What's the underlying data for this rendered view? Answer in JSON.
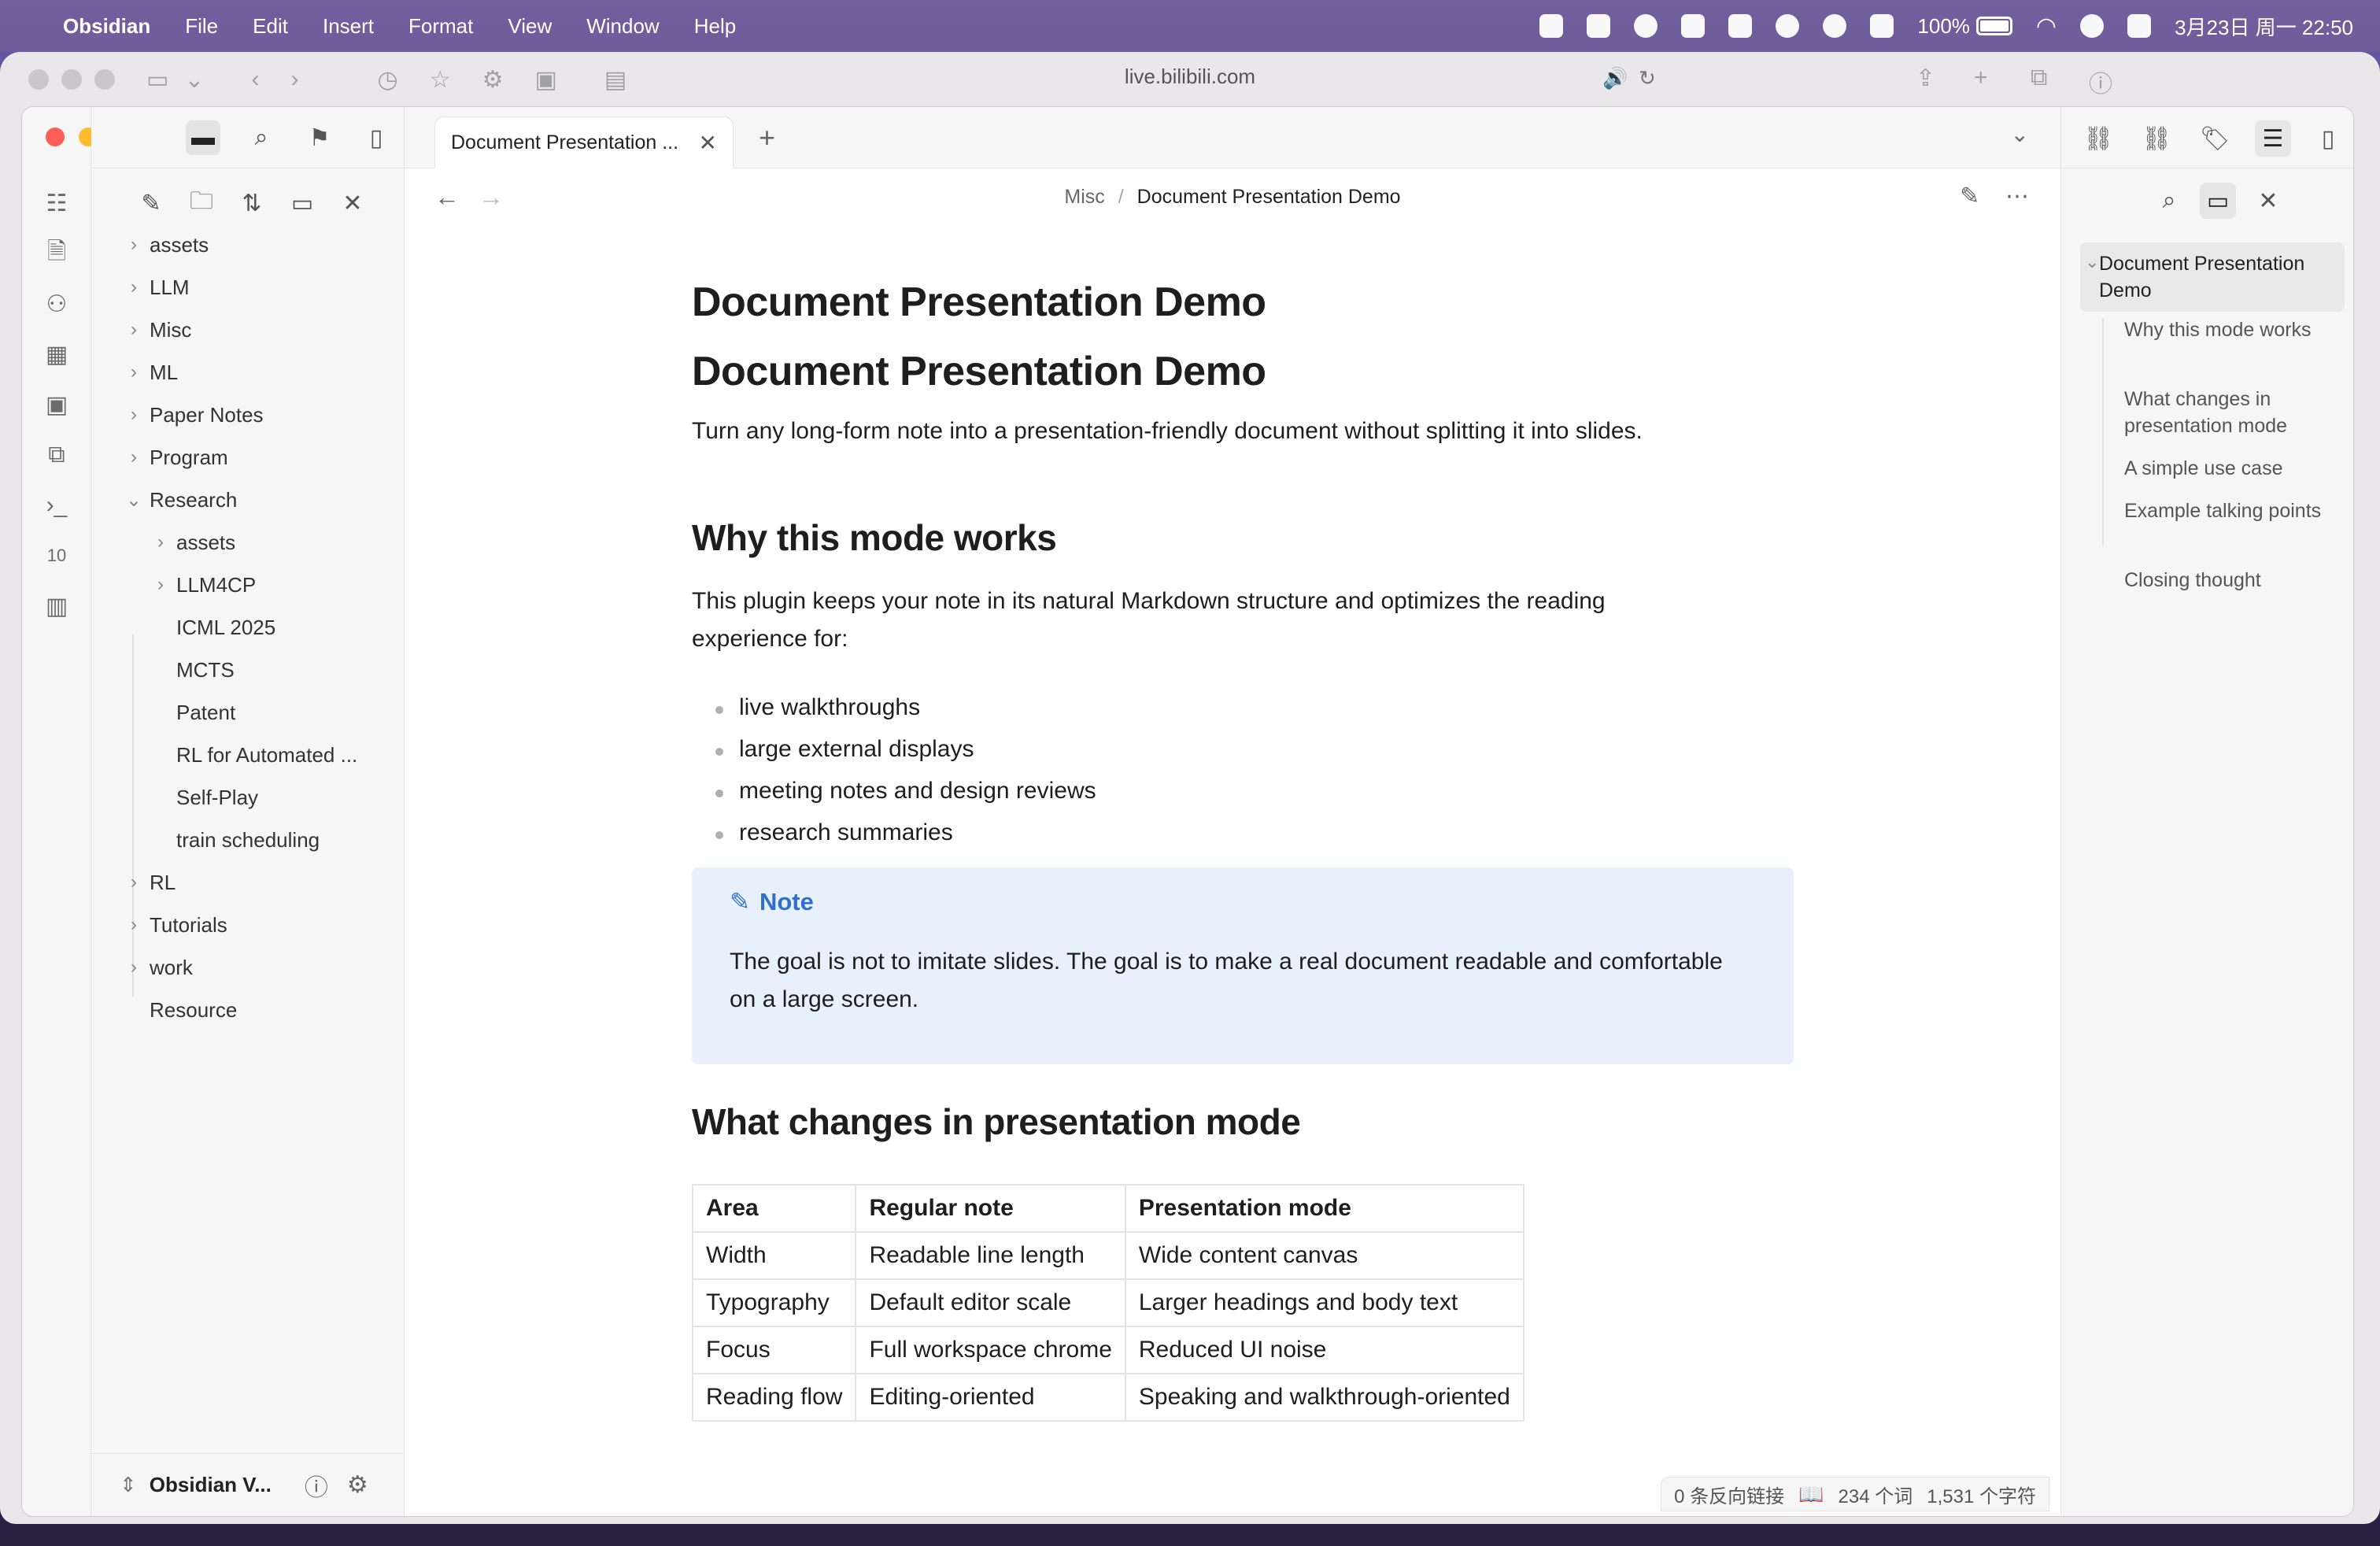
{
  "menubar": {
    "app": "Obsidian",
    "items": [
      "File",
      "Edit",
      "Insert",
      "Format",
      "View",
      "Window",
      "Help"
    ],
    "battery": "100%",
    "datetime": "3月23日 周一  22:50"
  },
  "browser": {
    "address": "live.bilibili.com"
  },
  "sidebar": {
    "tree": [
      {
        "label": "assets",
        "depth": 0,
        "folder": true,
        "open": false
      },
      {
        "label": "LLM",
        "depth": 0,
        "folder": true,
        "open": false
      },
      {
        "label": "Misc",
        "depth": 0,
        "folder": true,
        "open": false
      },
      {
        "label": "ML",
        "depth": 0,
        "folder": true,
        "open": false
      },
      {
        "label": "Paper Notes",
        "depth": 0,
        "folder": true,
        "open": false
      },
      {
        "label": "Program",
        "depth": 0,
        "folder": true,
        "open": false
      },
      {
        "label": "Research",
        "depth": 0,
        "folder": true,
        "open": true
      },
      {
        "label": "assets",
        "depth": 1,
        "folder": true,
        "open": false
      },
      {
        "label": "LLM4CP",
        "depth": 1,
        "folder": true,
        "open": false
      },
      {
        "label": "ICML 2025",
        "depth": 1,
        "folder": false
      },
      {
        "label": "MCTS",
        "depth": 1,
        "folder": false
      },
      {
        "label": "Patent",
        "depth": 1,
        "folder": false
      },
      {
        "label": "RL for Automated ...",
        "depth": 1,
        "folder": false
      },
      {
        "label": "Self-Play",
        "depth": 1,
        "folder": false
      },
      {
        "label": "train scheduling",
        "depth": 1,
        "folder": false
      },
      {
        "label": "RL",
        "depth": 0,
        "folder": true,
        "open": false
      },
      {
        "label": "Tutorials",
        "depth": 0,
        "folder": true,
        "open": false
      },
      {
        "label": "work",
        "depth": 0,
        "folder": true,
        "open": false
      },
      {
        "label": "Resource",
        "depth": 0,
        "folder": false
      }
    ],
    "vault": "Obsidian V..."
  },
  "tab": {
    "title": "Document Presentation ..."
  },
  "breadcrumb": {
    "folder": "Misc",
    "sep": "/",
    "current": "Document Presentation Demo"
  },
  "doc": {
    "title1": "Document Presentation Demo",
    "title2": "Document Presentation Demo",
    "intro": "Turn any long-form note into a presentation-friendly document without splitting it into slides.",
    "h_why": "Why this mode works",
    "why_text": "This plugin keeps your note in its natural Markdown structure and optimizes the reading experience for:",
    "bullets": [
      "live walkthroughs",
      "large external displays",
      "meeting notes and design reviews",
      "research summaries"
    ],
    "callout_title": "Note",
    "callout_body": "The goal is not to imitate slides. The goal is to make a real document readable and comfortable on a large screen.",
    "h_changes": "What changes in presentation mode",
    "table": {
      "headers": [
        "Area",
        "Regular note",
        "Presentation mode"
      ],
      "rows": [
        [
          "Width",
          "Readable line length",
          "Wide content canvas"
        ],
        [
          "Typography",
          "Default editor scale",
          "Larger headings and body text"
        ],
        [
          "Focus",
          "Full workspace chrome",
          "Reduced UI noise"
        ],
        [
          "Reading flow",
          "Editing-oriented",
          "Speaking and walkthrough-oriented"
        ]
      ]
    }
  },
  "status": {
    "backlinks": "0 条反向链接",
    "words": "234 个词",
    "chars": "1,531 个字符"
  },
  "outline": {
    "top": "Document Presentation Demo",
    "items": [
      "Why this mode works",
      "What changes in presentation mode",
      "A simple use case",
      "Example talking points",
      "Closing thought"
    ]
  },
  "colors": {
    "accent": "#2f6fd0",
    "callout_bg": "#e8f0fc",
    "close": "#fe5f57",
    "minimize": "#febc2e",
    "zoom": "#28c840"
  }
}
